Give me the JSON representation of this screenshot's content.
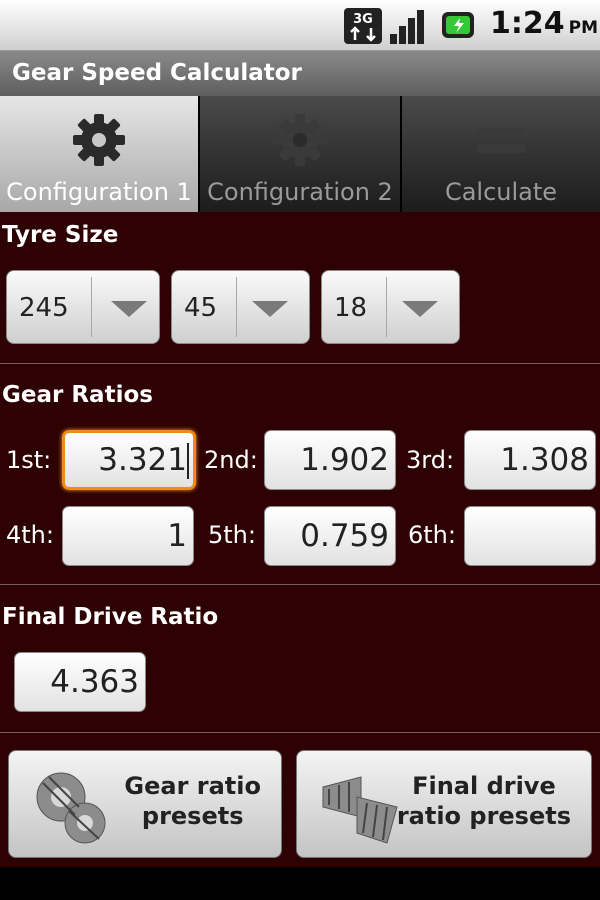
{
  "status_bar": {
    "network": "3G",
    "time": "1:24",
    "ampm": "PM"
  },
  "app_title": "Gear Speed Calculator",
  "tabs": [
    {
      "label": "Configuration 1",
      "icon": "gear-icon",
      "active": true
    },
    {
      "label": "Configuration 2",
      "icon": "gear-icon",
      "active": false
    },
    {
      "label": "Calculate",
      "icon": "equals-icon",
      "active": false
    }
  ],
  "tyre_size": {
    "title": "Tyre Size",
    "width": "245",
    "profile": "45",
    "rim": "18"
  },
  "gear_ratios": {
    "title": "Gear Ratios",
    "gears": [
      {
        "label": "1st:",
        "value": "3.321"
      },
      {
        "label": "2nd:",
        "value": "1.902"
      },
      {
        "label": "3rd:",
        "value": "1.308"
      },
      {
        "label": "4th:",
        "value": "1"
      },
      {
        "label": "5th:",
        "value": "0.759"
      },
      {
        "label": "6th:",
        "value": ""
      }
    ]
  },
  "final_drive": {
    "title": "Final Drive Ratio",
    "value": "4.363"
  },
  "buttons": {
    "gear_presets_line1": "Gear ratio",
    "gear_presets_line2": "presets",
    "final_presets_line1": "Final drive",
    "final_presets_line2": "ratio presets"
  },
  "colors": {
    "background": "#2e0203",
    "focus": "#f08a1c"
  }
}
